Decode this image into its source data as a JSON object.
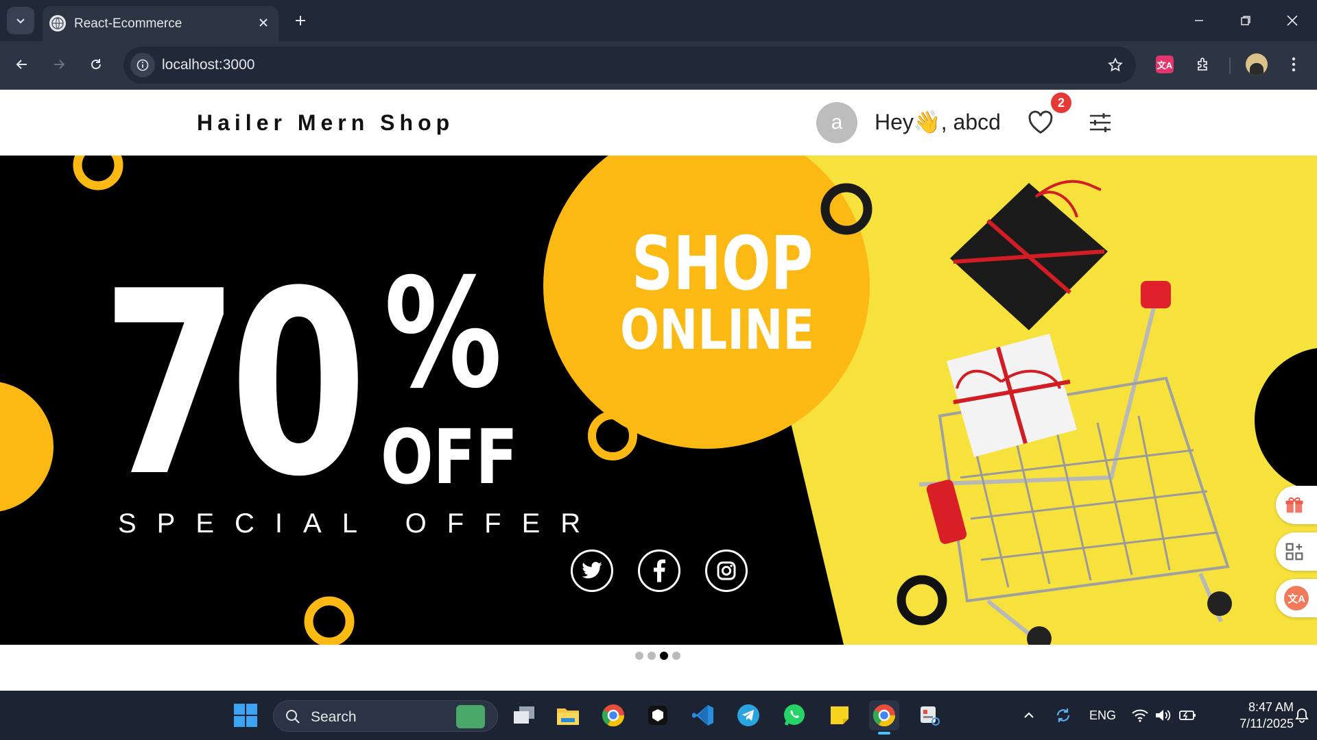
{
  "browser": {
    "tab_title": "React-Ecommerce",
    "url": "localhost:3000"
  },
  "header": {
    "brand": "Hailer Mern Shop",
    "avatar_letter": "a",
    "greeting": "Hey👋, abcd",
    "wishlist_count": "2"
  },
  "banner": {
    "deal_number": "70",
    "deal_percent": "%",
    "deal_off": "OFF",
    "deal_subtitle": "SPECIAL OFFER",
    "shop_line1": "SHOP",
    "shop_line2": "ONLINE",
    "social_icons": [
      "twitter-icon",
      "facebook-icon",
      "instagram-icon"
    ],
    "colors": {
      "accent": "#fdb913",
      "background": "#000000",
      "right_panel": "#f7e13d"
    }
  },
  "carousel": {
    "slide_count": 4,
    "active_index": 2
  },
  "taskbar": {
    "search_label": "Search",
    "language": "ENG",
    "time": "8:47 AM",
    "date": "7/11/2025"
  }
}
